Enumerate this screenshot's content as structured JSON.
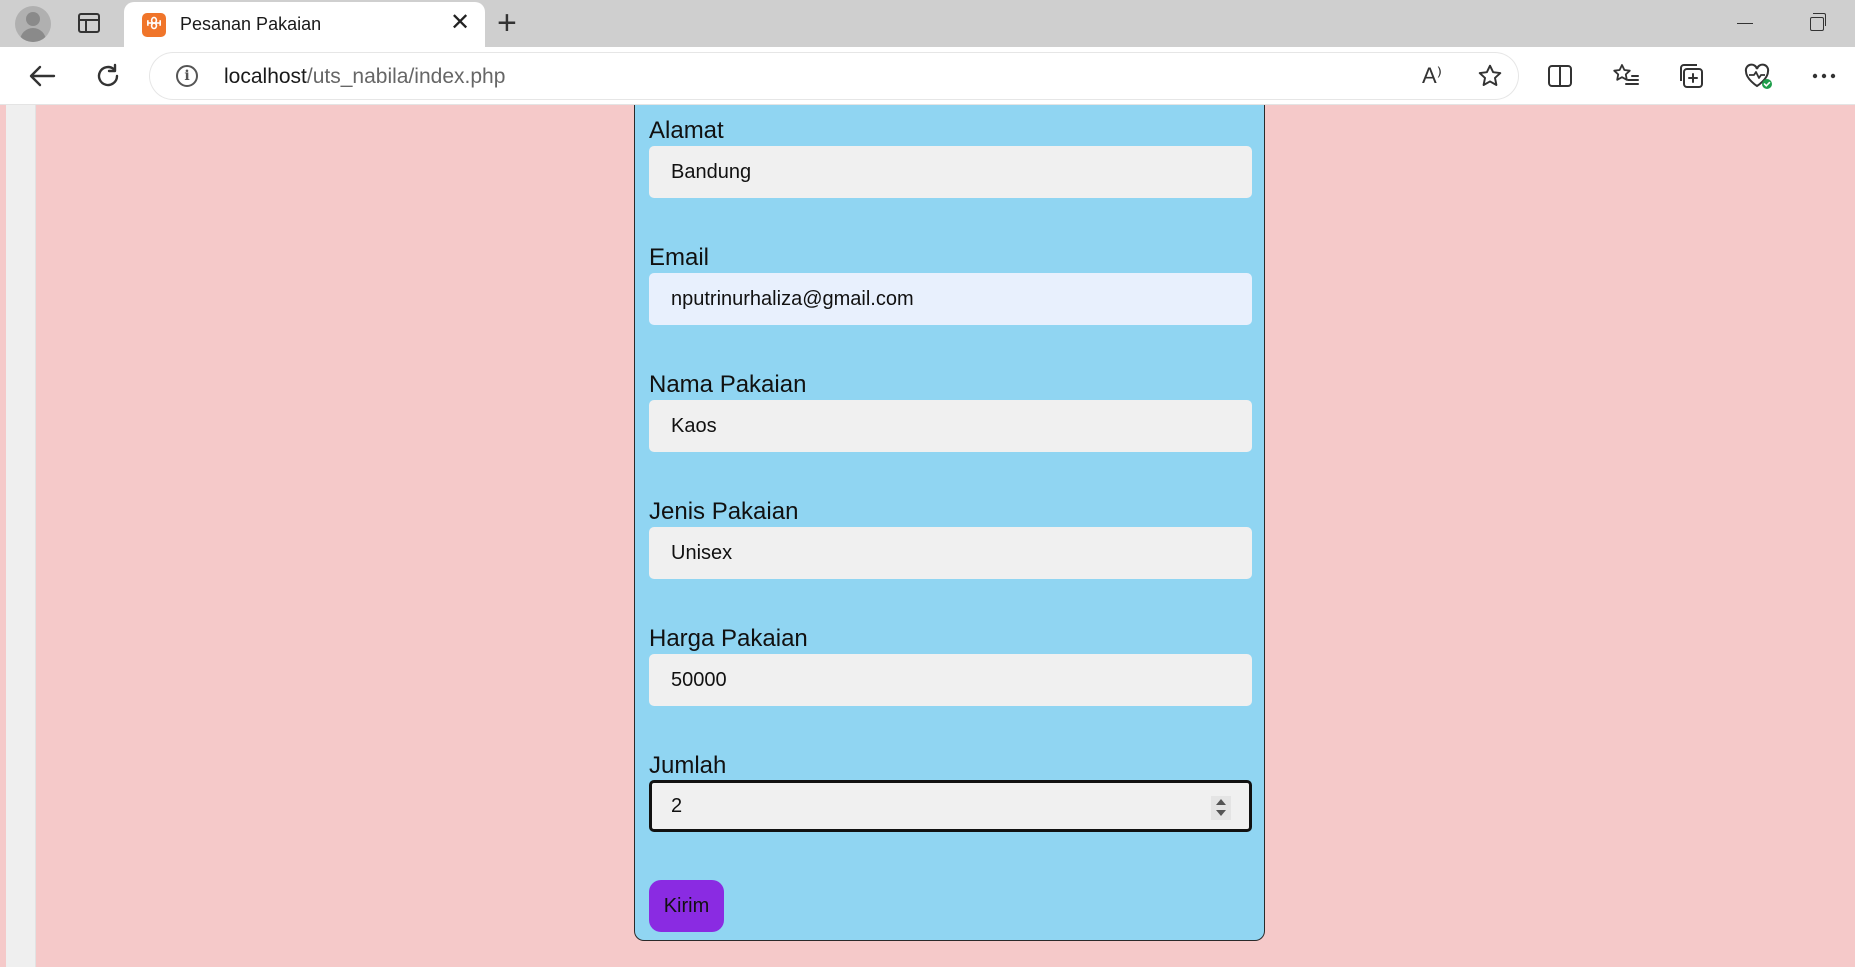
{
  "browser": {
    "tab_title": "Pesanan Pakaian",
    "favicon_glyph": "ꗳ",
    "url_host": "localhost",
    "url_path": "/uts_nabila/index.php",
    "read_aloud_glyph": "A⁾"
  },
  "form": {
    "fields": [
      {
        "label": "Alamat",
        "value": "Bandung"
      },
      {
        "label": "Email",
        "value": "nputrinurhaliza@gmail.com"
      },
      {
        "label": "Nama Pakaian",
        "value": "Kaos"
      },
      {
        "label": "Jenis Pakaian",
        "value": "Unisex"
      },
      {
        "label": "Harga Pakaian",
        "value": "50000"
      },
      {
        "label": "Jumlah",
        "value": "2"
      }
    ],
    "submit_label": "Kirim"
  },
  "colors": {
    "page_background": "#f5c9c9",
    "form_background": "#90d5f2",
    "submit_button": "#8a2be2"
  }
}
